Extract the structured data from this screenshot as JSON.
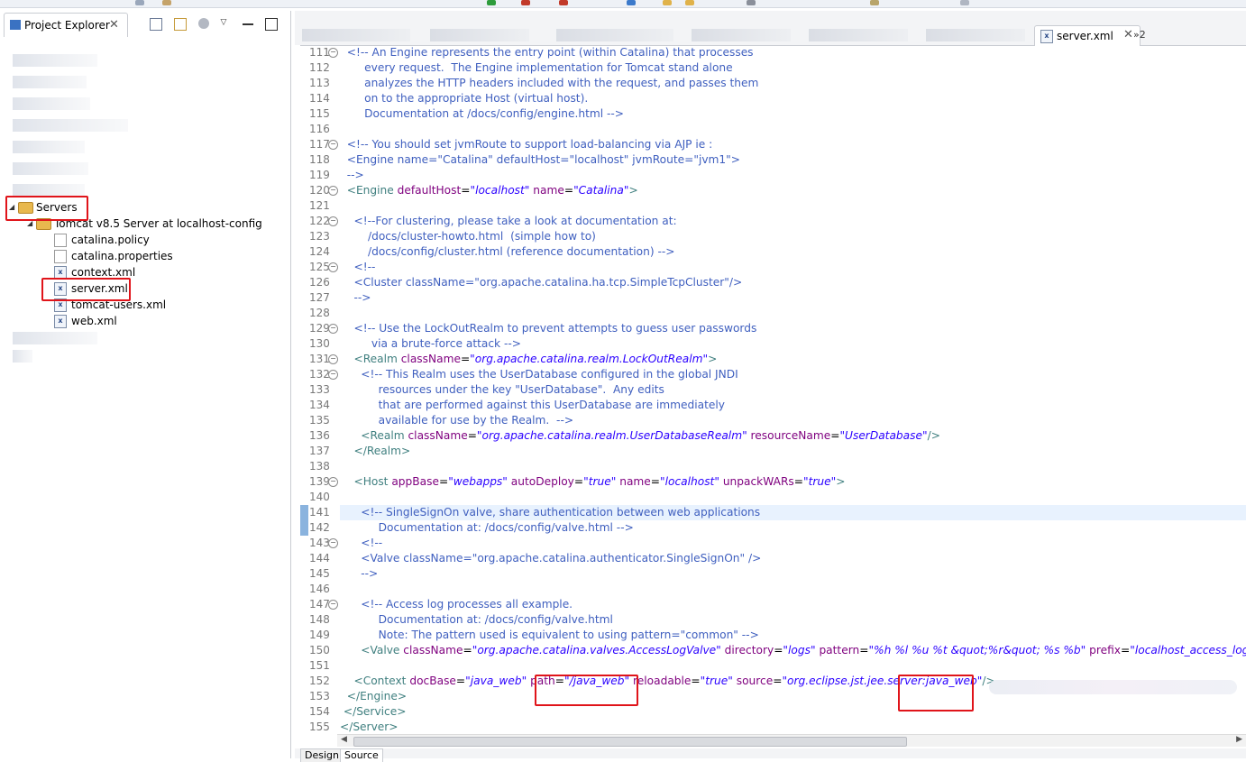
{
  "project_explorer": {
    "title": "Project Explorer",
    "tree": {
      "servers_label": "Servers",
      "server_label": "Tomcat v8.5 Server at localhost-config",
      "files": [
        "catalina.policy",
        "catalina.properties",
        "context.xml",
        "server.xml",
        "tomcat-users.xml",
        "web.xml"
      ]
    }
  },
  "editor": {
    "active_tab": "server.xml",
    "overflow_label": "»2",
    "bottom_tabs": [
      "Design",
      "Source"
    ],
    "highlight_line": 141,
    "lines": [
      {
        "n": 111,
        "fold": true,
        "html": "<span class=\"cm\">  &lt;!-- An Engine represents the entry point (within Catalina) that processes</span>"
      },
      {
        "n": 112,
        "html": "<span class=\"cm\">       every request.  The Engine implementation for Tomcat stand alone</span>"
      },
      {
        "n": 113,
        "html": "<span class=\"cm\">       analyzes the HTTP headers included with the request, and passes them</span>"
      },
      {
        "n": 114,
        "html": "<span class=\"cm\">       on to the appropriate Host (virtual host).</span>"
      },
      {
        "n": 115,
        "html": "<span class=\"cm\">       Documentation at /docs/config/engine.html --&gt;</span>"
      },
      {
        "n": 116,
        "html": ""
      },
      {
        "n": 117,
        "fold": true,
        "html": "<span class=\"cm\">  &lt;!-- You should set jvmRoute to support load-balancing via AJP ie :</span>"
      },
      {
        "n": 118,
        "html": "<span class=\"cm\">  &lt;Engine name=\"Catalina\" defaultHost=\"localhost\" jvmRoute=\"jvm1\"&gt;</span>"
      },
      {
        "n": 119,
        "html": "<span class=\"cm\">  --&gt;</span>"
      },
      {
        "n": 120,
        "fold": true,
        "html": "  <span class=\"tag\">&lt;Engine</span> <span class=\"attr\">defaultHost</span>=<span class=\"val\">\"localhost\"</span> <span class=\"attr\">name</span>=<span class=\"val\">\"Catalina\"</span><span class=\"tag\">&gt;</span>"
      },
      {
        "n": 121,
        "html": ""
      },
      {
        "n": 122,
        "fold": true,
        "html": "<span class=\"cm\">    &lt;!--For clustering, please take a look at documentation at:</span>"
      },
      {
        "n": 123,
        "html": "<span class=\"cm\">        /docs/cluster-howto.html  (simple how to)</span>"
      },
      {
        "n": 124,
        "html": "<span class=\"cm\">        /docs/config/cluster.html (reference documentation) --&gt;</span>"
      },
      {
        "n": 125,
        "fold": true,
        "html": "<span class=\"cm\">    &lt;!--</span>"
      },
      {
        "n": 126,
        "html": "<span class=\"cm\">    &lt;Cluster className=\"org.apache.catalina.ha.tcp.SimpleTcpCluster\"/&gt;</span>"
      },
      {
        "n": 127,
        "html": "<span class=\"cm\">    --&gt;</span>"
      },
      {
        "n": 128,
        "html": ""
      },
      {
        "n": 129,
        "fold": true,
        "html": "<span class=\"cm\">    &lt;!-- Use the LockOutRealm to prevent attempts to guess user passwords</span>"
      },
      {
        "n": 130,
        "html": "<span class=\"cm\">         via a brute-force attack --&gt;</span>"
      },
      {
        "n": 131,
        "fold": true,
        "html": "    <span class=\"tag\">&lt;Realm</span> <span class=\"attr\">className</span>=<span class=\"val\">\"org.apache.catalina.realm.LockOutRealm\"</span><span class=\"tag\">&gt;</span>"
      },
      {
        "n": 132,
        "fold": true,
        "html": "<span class=\"cm\">      &lt;!-- This Realm uses the UserDatabase configured in the global JNDI</span>"
      },
      {
        "n": 133,
        "html": "<span class=\"cm\">           resources under the key \"UserDatabase\".  Any edits</span>"
      },
      {
        "n": 134,
        "html": "<span class=\"cm\">           that are performed against this UserDatabase are immediately</span>"
      },
      {
        "n": 135,
        "html": "<span class=\"cm\">           available for use by the Realm.  --&gt;</span>"
      },
      {
        "n": 136,
        "html": "      <span class=\"tag\">&lt;Realm</span> <span class=\"attr\">className</span>=<span class=\"val\">\"org.apache.catalina.realm.UserDatabaseRealm\"</span> <span class=\"attr\">resourceName</span>=<span class=\"val\">\"UserDatabase\"</span><span class=\"tag\">/&gt;</span>"
      },
      {
        "n": 137,
        "html": "    <span class=\"tag\">&lt;/Realm&gt;</span>"
      },
      {
        "n": 138,
        "html": ""
      },
      {
        "n": 139,
        "fold": true,
        "html": "    <span class=\"tag\">&lt;Host</span> <span class=\"attr\">appBase</span>=<span class=\"val\">\"webapps\"</span> <span class=\"attr\">autoDeploy</span>=<span class=\"val\">\"true\"</span> <span class=\"attr\">name</span>=<span class=\"val\">\"localhost\"</span> <span class=\"attr\">unpackWARs</span>=<span class=\"val\">\"true\"</span><span class=\"tag\">&gt;</span>"
      },
      {
        "n": 140,
        "html": ""
      },
      {
        "n": 141,
        "html": "<span class=\"cm\">      &lt;!-- SingleSignOn valve, share authentication between web applications</span>"
      },
      {
        "n": 142,
        "html": "<span class=\"cm\">           Documentation at: /docs/config/valve.html --&gt;</span>"
      },
      {
        "n": 143,
        "fold": true,
        "html": "<span class=\"cm\">      &lt;!--</span>"
      },
      {
        "n": 144,
        "html": "<span class=\"cm\">      &lt;Valve className=\"org.apache.catalina.authenticator.SingleSignOn\" /&gt;</span>"
      },
      {
        "n": 145,
        "html": "<span class=\"cm\">      --&gt;</span>"
      },
      {
        "n": 146,
        "html": ""
      },
      {
        "n": 147,
        "fold": true,
        "html": "<span class=\"cm\">      &lt;!-- Access log processes all example.</span>"
      },
      {
        "n": 148,
        "html": "<span class=\"cm\">           Documentation at: /docs/config/valve.html</span>"
      },
      {
        "n": 149,
        "html": "<span class=\"cm\">           Note: The pattern used is equivalent to using pattern=\"common\" --&gt;</span>"
      },
      {
        "n": 150,
        "html": "      <span class=\"tag\">&lt;Valve</span> <span class=\"attr\">className</span>=<span class=\"val\">\"org.apache.catalina.valves.AccessLogValve\"</span> <span class=\"attr\">directory</span>=<span class=\"val\">\"logs\"</span> <span class=\"attr\">pattern</span>=<span class=\"val\">\"%h %l %u %t &amp;quot;%r&amp;quot; %s %b\"</span> <span class=\"attr\">prefix</span>=<span class=\"val\">\"localhost_access_log\"</span>"
      },
      {
        "n": 151,
        "html": ""
      },
      {
        "n": 152,
        "html": "    <span class=\"tag\">&lt;Context</span> <span class=\"attr\">docBase</span>=<span class=\"val\">\"java_web\"</span> <span class=\"attr\">path</span>=<span class=\"val\">\"/java_web\"</span> <span class=\"attr\">reloadable</span>=<span class=\"val\">\"true\"</span> <span class=\"attr\">source</span>=<span class=\"val\">\"org.eclipse.jst.jee.server:java_web\"</span><span class=\"tag\">/&gt;</span>"
      },
      {
        "n": 153,
        "html": "  <span class=\"tag\">&lt;/Engine&gt;</span>"
      },
      {
        "n": 154,
        "html": " <span class=\"tag\">&lt;/Service&gt;</span>"
      },
      {
        "n": 155,
        "html": "<span class=\"tag\">&lt;/Server&gt;</span>"
      }
    ]
  },
  "colors": {
    "highlight_box": "#e0141a",
    "comment": "#3f5fbf",
    "tag": "#3f7f7f",
    "attribute": "#7f007f",
    "value": "#2a00ff",
    "current_line": "#e8f2fe"
  }
}
